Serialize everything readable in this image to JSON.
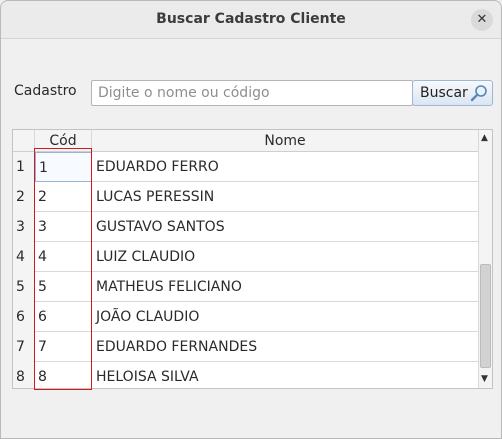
{
  "window": {
    "title": "Buscar Cadastro Cliente",
    "close_icon": "close-icon"
  },
  "search": {
    "label": "Cadastro",
    "placeholder": "Digite o nome ou código",
    "value": "",
    "button_label": "Buscar",
    "button_icon": "magnifier-icon"
  },
  "table": {
    "columns": [
      "Cód",
      "Nome"
    ],
    "rows": [
      {
        "num": "1",
        "cod": "1",
        "nome": "EDUARDO FERRO"
      },
      {
        "num": "2",
        "cod": "2",
        "nome": "LUCAS PERESSIN"
      },
      {
        "num": "3",
        "cod": "3",
        "nome": "GUSTAVO SANTOS"
      },
      {
        "num": "4",
        "cod": "4",
        "nome": "LUIZ CLAUDIO"
      },
      {
        "num": "5",
        "cod": "5",
        "nome": "MATHEUS FELICIANO"
      },
      {
        "num": "6",
        "cod": "6",
        "nome": "JOÃO CLAUDIO"
      },
      {
        "num": "7",
        "cod": "7",
        "nome": "EDUARDO FERNANDES"
      },
      {
        "num": "8",
        "cod": "8",
        "nome": "HELOISA SILVA"
      }
    ]
  },
  "colors": {
    "highlight_border": "#d41818",
    "selection_border": "#93b4d6"
  }
}
